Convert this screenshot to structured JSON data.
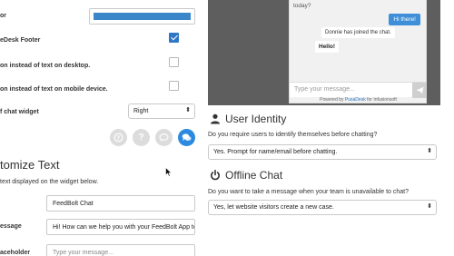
{
  "settings": {
    "color_label": "or",
    "footer_label": "eDesk Footer",
    "desktop_icon_label": "on instead of text on desktop.",
    "mobile_icon_label": "on instead of text on mobile device.",
    "position_label": "f chat widget",
    "position_value": "Right",
    "accent_color": "#3a86c9",
    "checkbox_footer_checked": true,
    "checkbox_desktop_checked": false,
    "checkbox_mobile_checked": false
  },
  "icon_choices": {
    "help_glyph": "?",
    "question_glyph": "?"
  },
  "customize": {
    "title": "tomize Text",
    "description": "text displayed on the widget below.",
    "chat_title_value": "FeedBolt Chat",
    "message_label": "essage",
    "message_value": "Hi! How can we help you with your FeedBolt App today?",
    "placeholder_label": "aceholder",
    "placeholder_value": "Type your message..."
  },
  "preview": {
    "today": "today?",
    "user_message": "Hi there!",
    "system_message": "Donnie has joined the chat.",
    "agent_message": "Hello!",
    "input_placeholder": "Type your message...",
    "powered_prefix": "Powered by",
    "powered_link": "PusaDesk",
    "powered_suffix": "for Infusionsoft"
  },
  "user_identity": {
    "title": "User Identity",
    "question": "Do you require users to identify themselves before chatting?",
    "select_value": "Yes. Prompt for name/email before chatting."
  },
  "offline_chat": {
    "title": "Offline Chat",
    "question": "Do you want to take a message when your team is unavailable to chat?",
    "select_value": "Yes, let website visitors create a new case."
  },
  "icons": {
    "chat_bubble": "chat-bubble-icon",
    "user": "user-icon",
    "power": "power-icon",
    "send": "send-icon"
  }
}
